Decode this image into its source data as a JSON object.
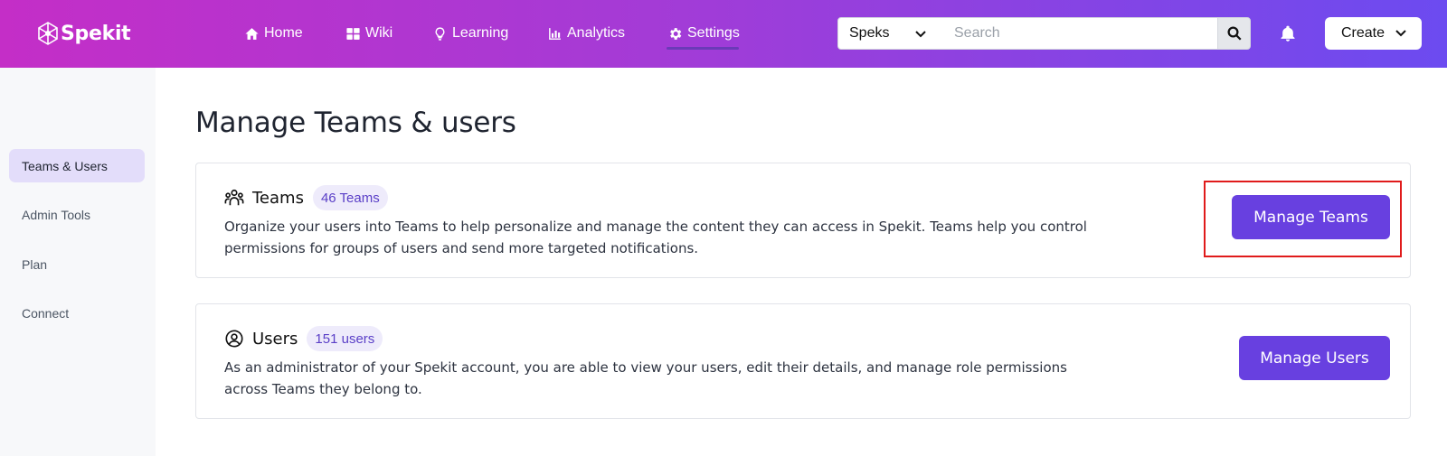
{
  "app": {
    "logo_text": "Spekit"
  },
  "nav": {
    "items": [
      {
        "label": "Home",
        "icon": "home-icon"
      },
      {
        "label": "Wiki",
        "icon": "grid-icon"
      },
      {
        "label": "Learning",
        "icon": "lightbulb-icon"
      },
      {
        "label": "Analytics",
        "icon": "bar-chart-icon"
      },
      {
        "label": "Settings",
        "icon": "gear-icon",
        "active": true
      }
    ]
  },
  "search": {
    "scope": "Speks",
    "placeholder": "Search"
  },
  "header": {
    "create_label": "Create"
  },
  "sidebar": {
    "items": [
      {
        "label": "Teams & Users",
        "active": true
      },
      {
        "label": "Admin Tools"
      },
      {
        "label": "Plan"
      },
      {
        "label": "Connect"
      }
    ]
  },
  "main": {
    "title": "Manage Teams & users",
    "teams_card": {
      "title": "Teams",
      "badge": "46 Teams",
      "description": "Organize your users into Teams to help personalize and manage the content they can access in Spekit. Teams help you control permissions for groups of users and send more targeted notifications.",
      "button": "Manage Teams"
    },
    "users_card": {
      "title": "Users",
      "badge": "151 users",
      "description": "As an administrator of your Spekit account, you are able to view your users, edit their details, and manage role permissions across Teams they belong to.",
      "button": "Manage Users"
    }
  },
  "colors": {
    "header_gradient_start": "#c42ec7",
    "header_gradient_end": "#6c4bf0",
    "primary": "#6840e0",
    "sidebar_active": "#e3ddfa",
    "highlight": "#e01b1b"
  }
}
